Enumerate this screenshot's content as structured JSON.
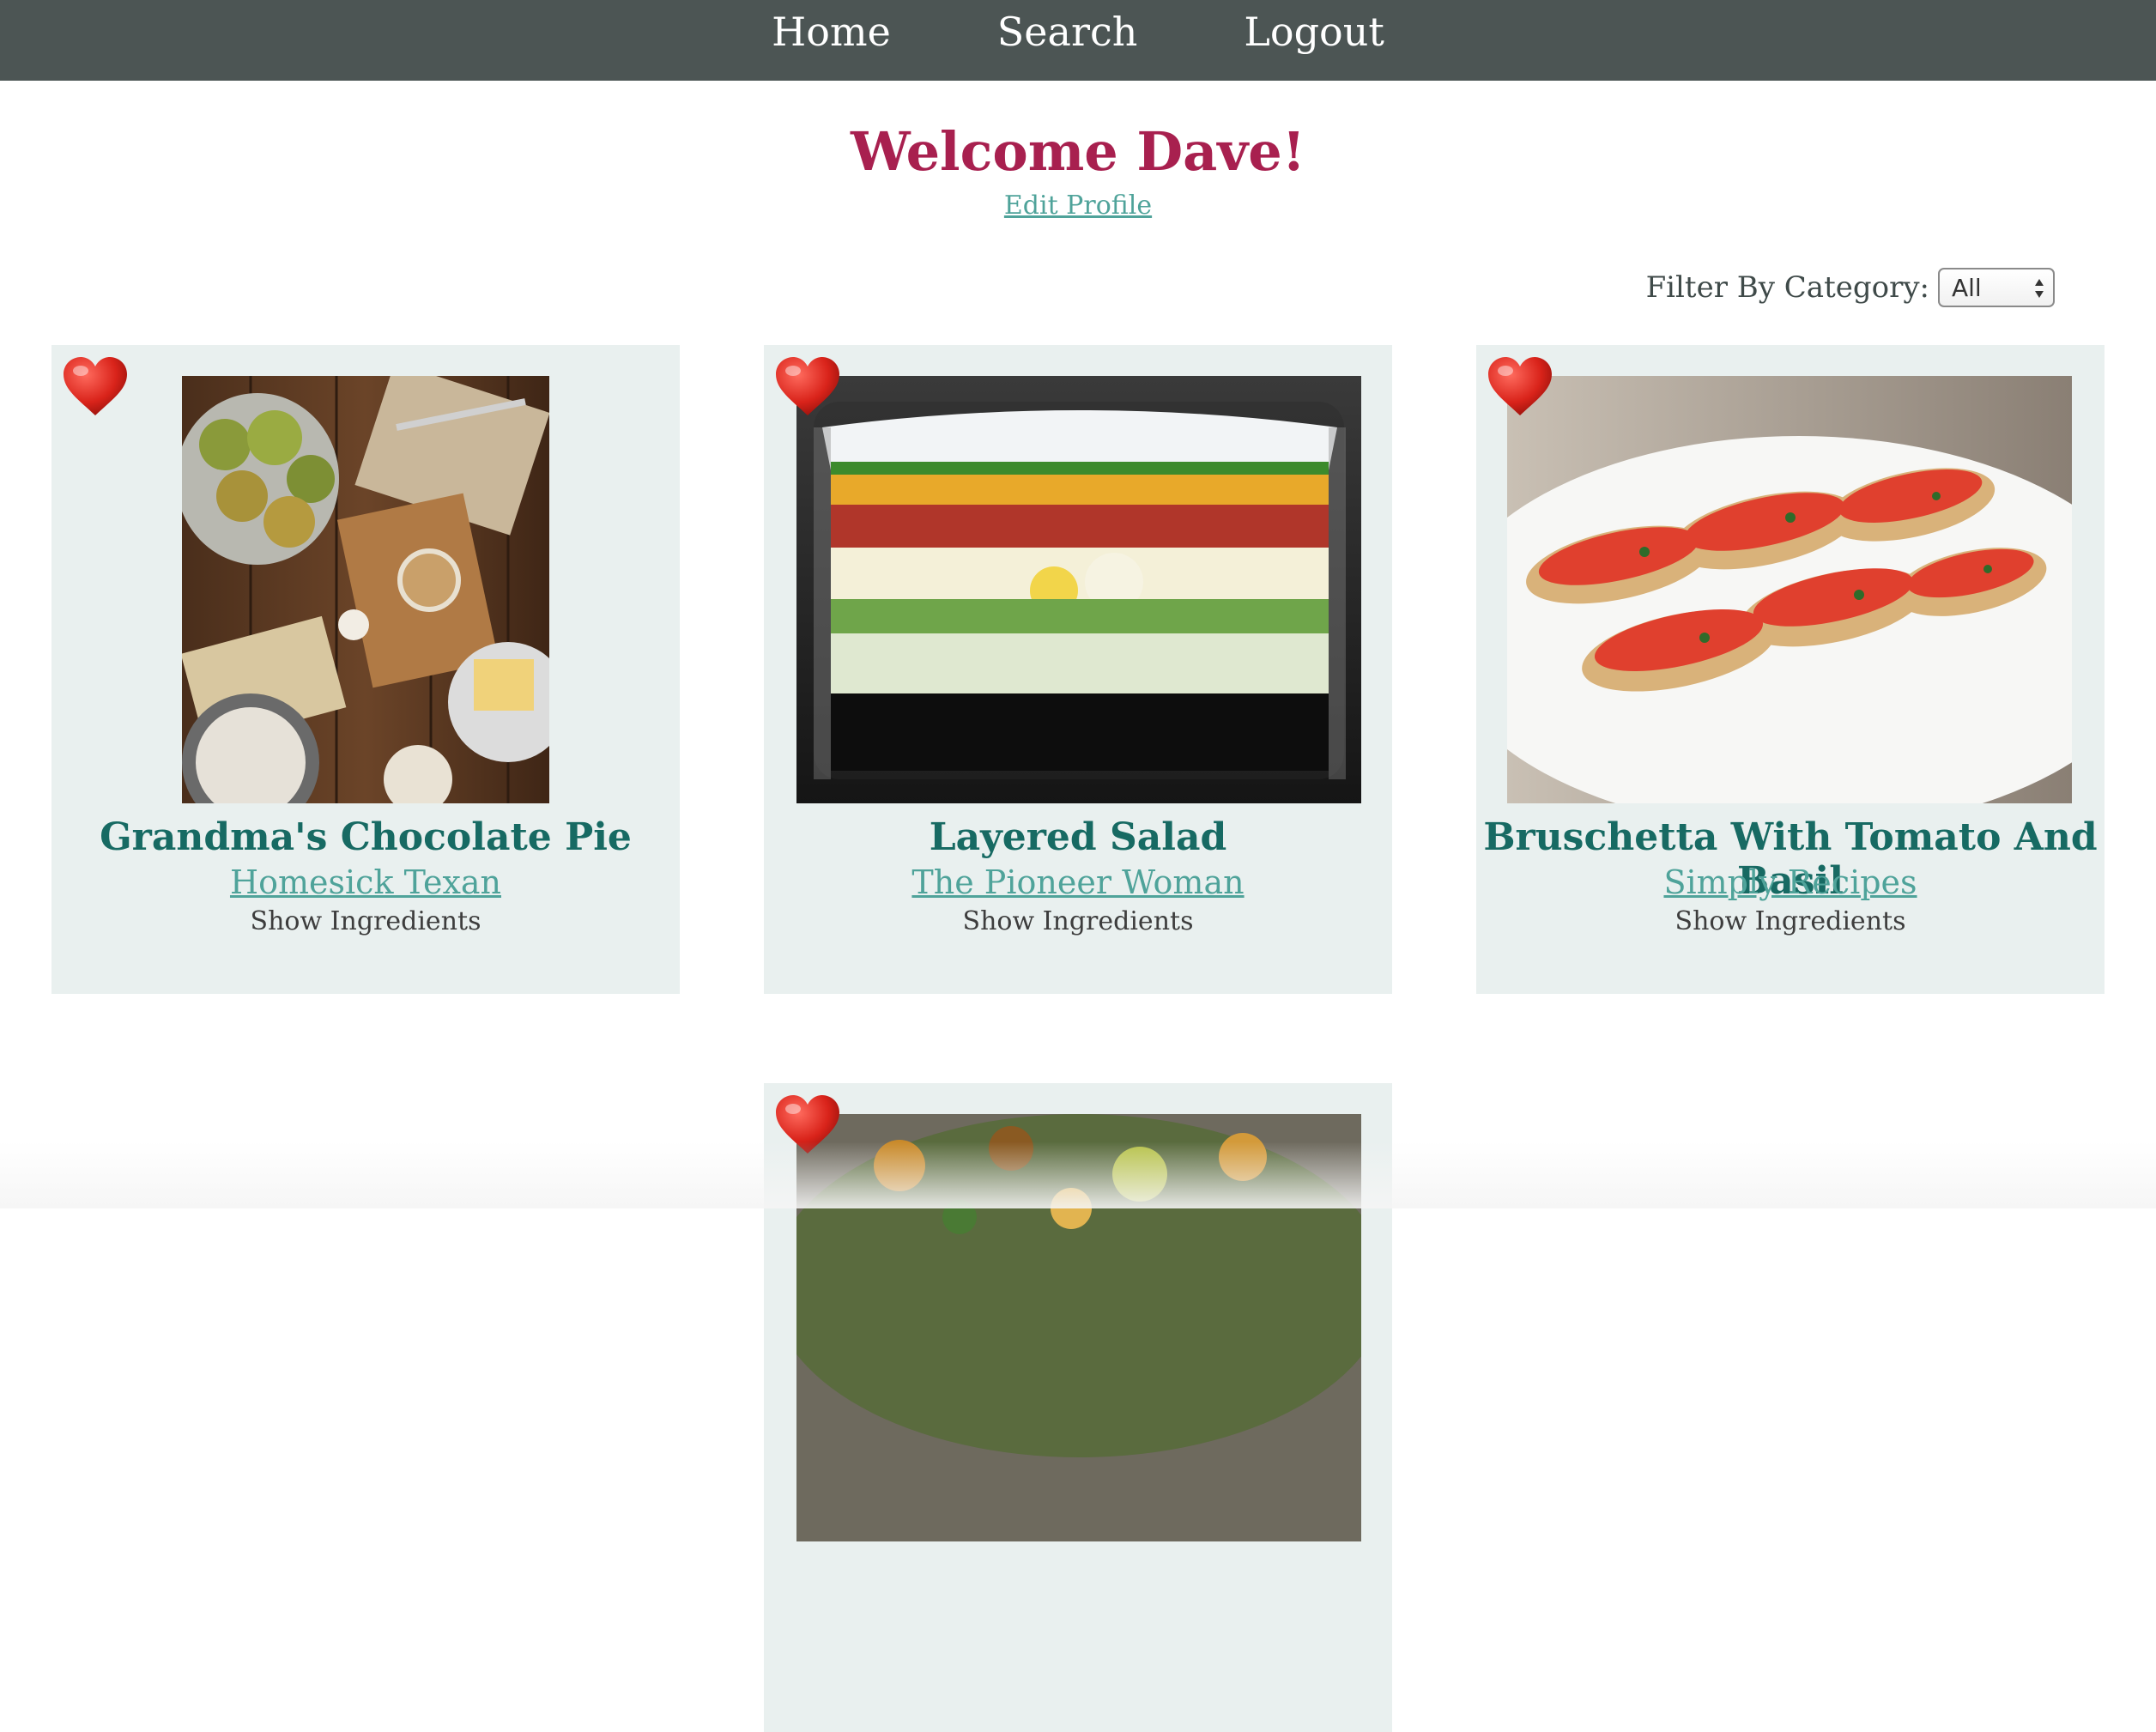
{
  "nav": {
    "home": "Home",
    "search": "Search",
    "logout": "Logout",
    "bg_color": "#4c5554"
  },
  "welcome": {
    "title": "Welcome Dave!",
    "edit_profile": "Edit Profile"
  },
  "filter": {
    "label": "Filter By Category:",
    "selected": "All"
  },
  "recipes": [
    {
      "title": "Grandma's Chocolate Pie",
      "source": "Homesick Texan",
      "ingredients_label": "Show Ingredients",
      "favorite": true,
      "image": "photo of rustic wooden table with apples, whisk, butter, flour and baking ingredients"
    },
    {
      "title": "Layered Salad",
      "source": "The Pioneer Woman",
      "ingredients_label": "Show Ingredients",
      "favorite": true,
      "image": "photo of layered salad in a glass bowl with lettuce, eggs, bacon, cheese and peas"
    },
    {
      "title": "Bruschetta With Tomato And Basil",
      "source": "Simply Recipes",
      "ingredients_label": "Show Ingredients",
      "favorite": true,
      "image": "photo of bruschetta toasts topped with diced tomato and basil on a white plate"
    },
    {
      "title": "",
      "source": "",
      "ingredients_label": "",
      "favorite": true,
      "image": "photo of roasted grain and vegetable dish"
    }
  ],
  "colors": {
    "accent": "#a8204f",
    "card_bg": "#e9f0ef",
    "title_teal": "#176a63",
    "link_teal": "#4fa39a"
  }
}
